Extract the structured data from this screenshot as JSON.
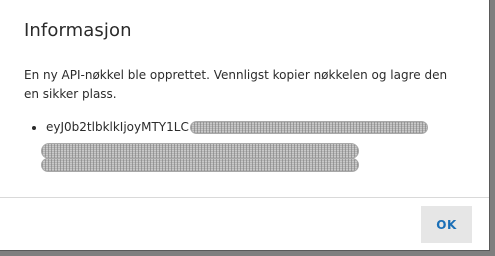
{
  "dialog": {
    "title": "Informasjon",
    "message": "En ny API-nøkkel ble opprettet. Vennligst kopier nøkkelen og lagre den en sikker plass.",
    "key_visible": "eyJ0b2tlbklkIjoyMTY1LC",
    "ok_label": "OK"
  },
  "colors": {
    "accent": "#1a6fb7",
    "button_bg": "#e6e6e6",
    "backdrop": "#7f7f7f"
  }
}
